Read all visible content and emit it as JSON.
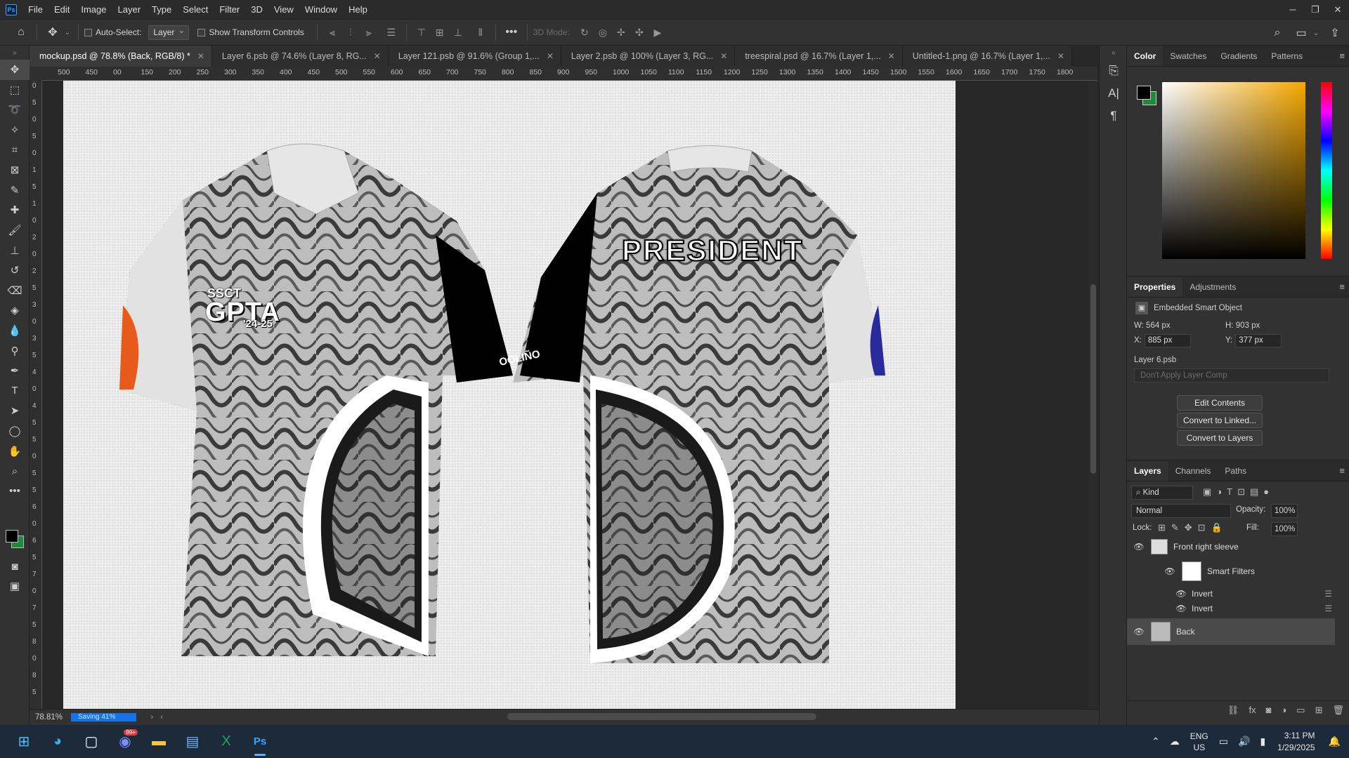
{
  "app": {
    "name": "Ps"
  },
  "menu": [
    "File",
    "Edit",
    "Image",
    "Layer",
    "Type",
    "Select",
    "Filter",
    "3D",
    "View",
    "Window",
    "Help"
  ],
  "options": {
    "auto_select_label": "Auto-Select:",
    "auto_select_value": "Layer",
    "transform_label": "Show Transform Controls",
    "more": "•••",
    "mode_3d": "3D Mode:"
  },
  "tabs": [
    {
      "label": "mockup.psd @ 78.8% (Back, RGB/8) *",
      "active": true
    },
    {
      "label": "Layer 6.psb @ 74.6% (Layer 8, RG...",
      "active": false
    },
    {
      "label": "Layer 121.psb @ 91.6% (Group 1,...",
      "active": false
    },
    {
      "label": "Layer 2.psb @ 100% (Layer 3, RG...",
      "active": false
    },
    {
      "label": "treespiral.psd @ 16.7% (Layer 1,...",
      "active": false
    },
    {
      "label": "Untitled-1.png @ 16.7% (Layer 1,...",
      "active": false
    }
  ],
  "ruler_h": [
    "500",
    "450",
    "00",
    "150",
    "200",
    "250",
    "300",
    "350",
    "400",
    "450",
    "500",
    "550",
    "600",
    "650",
    "700",
    "750",
    "800",
    "850",
    "900",
    "950",
    "1000",
    "1050",
    "1100",
    "1150",
    "1200",
    "1250",
    "1300",
    "1350",
    "1400",
    "1450",
    "1500",
    "1550",
    "1600",
    "1650",
    "1700",
    "1750",
    "1800"
  ],
  "ruler_v": [
    "0",
    "5",
    "0",
    "5",
    "0",
    "1",
    "5",
    "1",
    "0",
    "2",
    "0",
    "2",
    "5",
    "3",
    "0",
    "3",
    "5",
    "4",
    "0",
    "4",
    "5",
    "5",
    "0",
    "5",
    "5",
    "6",
    "0",
    "6",
    "5",
    "7",
    "0",
    "7",
    "5",
    "8",
    "0",
    "8",
    "5"
  ],
  "artwork": {
    "front_logo_line1": "SSCT",
    "front_logo_line2": "GPTA",
    "front_logo_line3": "'24-25",
    "back_title": "PRESIDENT",
    "collar_text": "OOLIÑO"
  },
  "status": {
    "zoom": "78.81%",
    "saving": "Saving 41%"
  },
  "right_panels": {
    "color_tabs": [
      "Color",
      "Swatches",
      "Gradients",
      "Patterns"
    ],
    "props_tabs": [
      "Properties",
      "Adjustments"
    ],
    "object_type": "Embedded Smart Object",
    "w_label": "W:",
    "w_value": "564 px",
    "h_label": "H:",
    "h_value": "903 px",
    "x_label": "X:",
    "x_value": "885 px",
    "y_label": "Y:",
    "y_value": "377 px",
    "linked_file": "Layer 6.psb",
    "layer_comp": "Don't Apply Layer Comp",
    "buttons": [
      "Edit Contents",
      "Convert to Linked...",
      "Convert to Layers"
    ]
  },
  "layers": {
    "tabs": [
      "Layers",
      "Channels",
      "Paths"
    ],
    "filter_kind": "Kind",
    "blend_mode": "Normal",
    "opacity_label": "Opacity:",
    "opacity_value": "100%",
    "lock_label": "Lock:",
    "fill_label": "Fill:",
    "fill_value": "100%",
    "rows": [
      {
        "name": "Front right sleeve"
      },
      {
        "name": "Smart Filters"
      },
      {
        "name": "Invert"
      },
      {
        "name": "Invert"
      },
      {
        "name": "Back"
      }
    ],
    "footer_fx": "fx"
  },
  "taskbar": {
    "lang_line1": "ENG",
    "lang_line2": "US",
    "time": "3:11 PM",
    "date": "1/29/2025",
    "badge": "99+"
  },
  "colors": {
    "foreground": "#000000",
    "background": "#1e8a3a",
    "accent": "#31a8ff"
  }
}
